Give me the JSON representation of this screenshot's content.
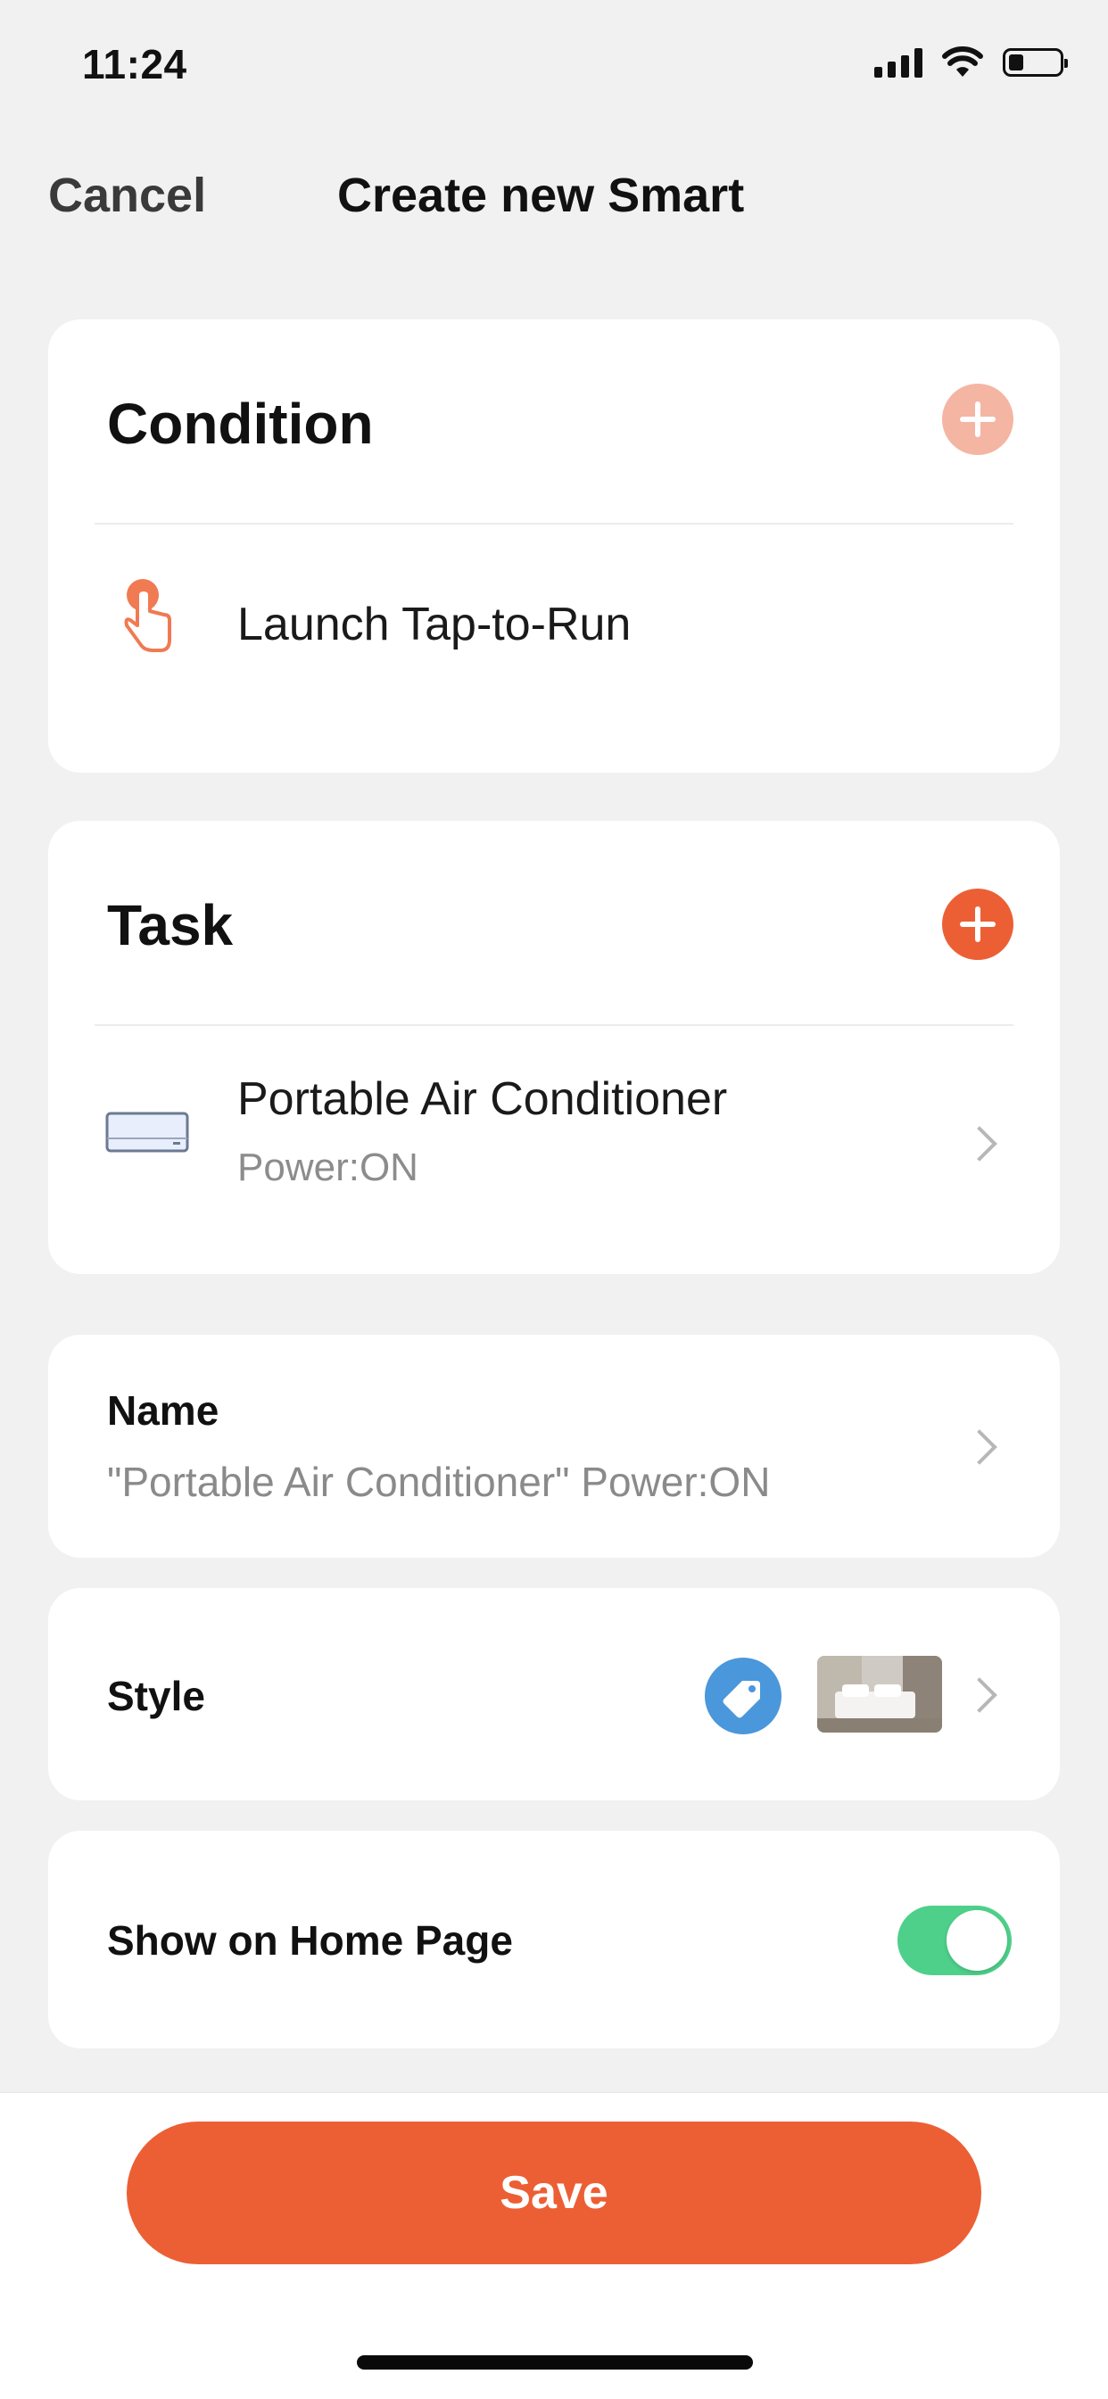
{
  "status_bar": {
    "time": "11:24"
  },
  "nav": {
    "cancel_label": "Cancel",
    "title": "Create new Smart"
  },
  "condition": {
    "title": "Condition",
    "item_label": "Launch Tap-to-Run",
    "accent_color": "#f4b5a3"
  },
  "task": {
    "title": "Task",
    "device_name": "Portable Air Conditioner",
    "device_status": "Power:ON",
    "accent_color": "#ec5f35"
  },
  "name_field": {
    "label": "Name",
    "value": "\"Portable Air Conditioner\" Power:ON"
  },
  "style_field": {
    "label": "Style",
    "icon": "tag-icon",
    "icon_color": "#4a97db",
    "thumbnail": "bedroom-thumbnail"
  },
  "home_page": {
    "label": "Show on Home Page",
    "enabled": true,
    "toggle_color": "#4ed08a"
  },
  "save_button": {
    "label": "Save",
    "color": "#ec5f35"
  }
}
